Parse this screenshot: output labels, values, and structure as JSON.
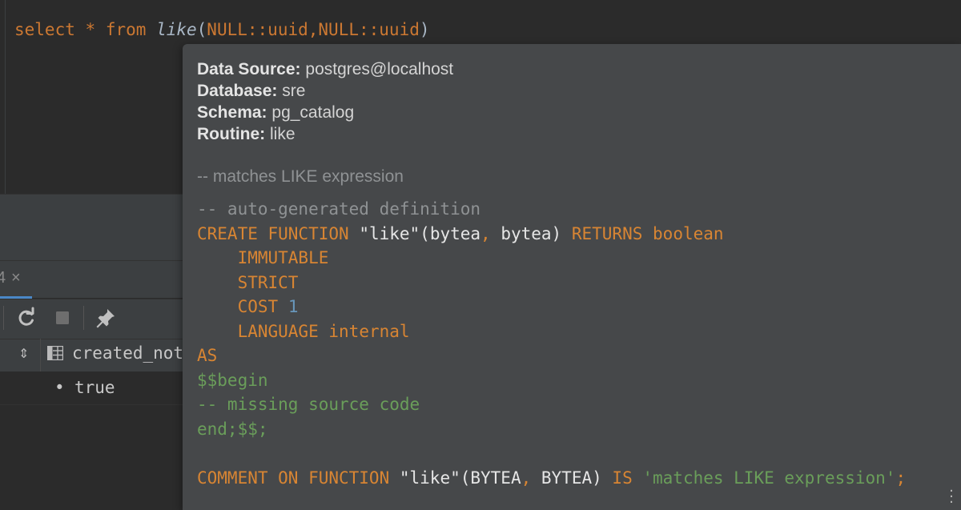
{
  "editor": {
    "query": {
      "select": "select",
      "star": "*",
      "from": "from",
      "func": "like",
      "open": "(",
      "arg1": "NULL",
      "cast1": "::",
      "type1": "uuid",
      "comma": ",",
      "arg2": "NULL",
      "cast2": "::",
      "type2": "uuid",
      "close": ")"
    }
  },
  "results": {
    "tab_label": "4",
    "tab_close": "×",
    "toolbar": {
      "refresh_icon": "refresh-icon",
      "stop_icon": "stop-icon",
      "pin_icon": "pin-icon"
    },
    "sort_icon": "⇕",
    "column_header": "created_not",
    "row_bullet": "•",
    "cell_value": "true"
  },
  "doc_popup": {
    "data_source_label": "Data Source:",
    "data_source_value": "postgres@localhost",
    "database_label": "Database:",
    "database_value": "sre",
    "schema_label": "Schema:",
    "schema_value": "pg_catalog",
    "routine_label": "Routine:",
    "routine_value": "like",
    "description": "-- matches LIKE expression",
    "code": {
      "comment1": "-- auto-generated definition",
      "create": "CREATE FUNCTION",
      "fname": "\"like\"",
      "params_open": "(bytea",
      "params_comma": ",",
      "params_close": " bytea)",
      "returns": "RETURNS",
      "ret_type": "boolean",
      "immutable": "IMMUTABLE",
      "strict": "STRICT",
      "cost": "COST",
      "cost_val": "1",
      "language": "LANGUAGE",
      "lang_val": "internal",
      "as": "AS",
      "begin": "$$begin",
      "missing": "-- missing source code",
      "end": "end;$$;",
      "comment_kw": "COMMENT ON FUNCTION",
      "cfname": "\"like\"",
      "cparams_open": "(BYTEA",
      "cparams_comma": ",",
      "cparams_close": " BYTEA)",
      "is": "IS",
      "cstring": "'matches LIKE expression'",
      "semicolon": ";"
    }
  },
  "colors": {
    "keyword": "#cc7832",
    "string": "#6a9e5a",
    "number": "#6897bb",
    "popup_bg": "#46484a",
    "editor_bg": "#2b2b2b"
  }
}
